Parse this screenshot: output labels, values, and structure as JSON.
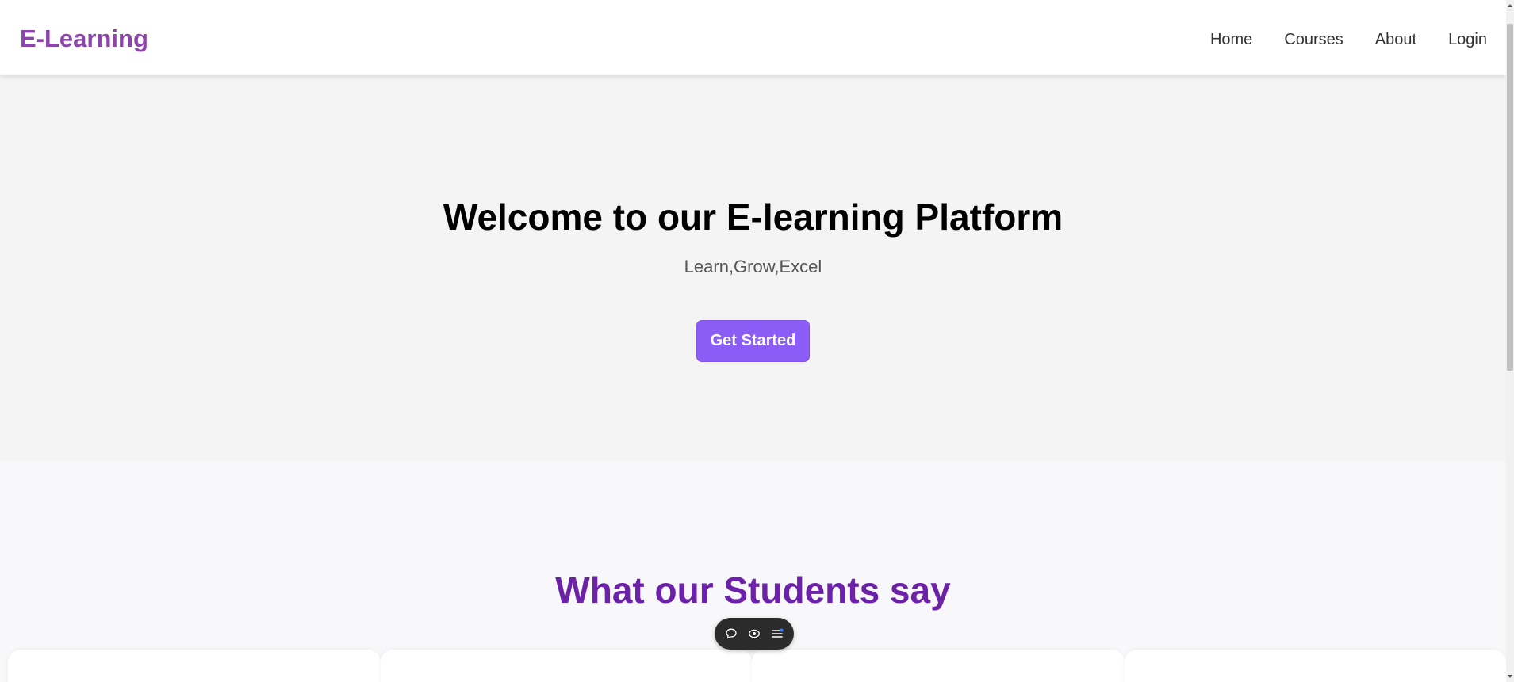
{
  "navbar": {
    "brand": "E-Learning",
    "links": [
      {
        "label": "Home"
      },
      {
        "label": "Courses"
      },
      {
        "label": "About"
      },
      {
        "label": "Login"
      }
    ]
  },
  "hero": {
    "title": "Welcome to our E-learning Platform",
    "subtitle": "Learn,Grow,Excel",
    "cta_label": "Get Started"
  },
  "testimonials": {
    "title": "What our Students say"
  },
  "toolbar": {
    "icons": [
      "chat-bubble-icon",
      "eye-icon",
      "menu-list-icon"
    ]
  },
  "colors": {
    "brand": "#8e44ad",
    "accent_button": "#8b5cf6",
    "section_title": "#6b21a8",
    "hero_bg": "#f4f4f4",
    "testimonials_bg": "#f8f7fa"
  }
}
